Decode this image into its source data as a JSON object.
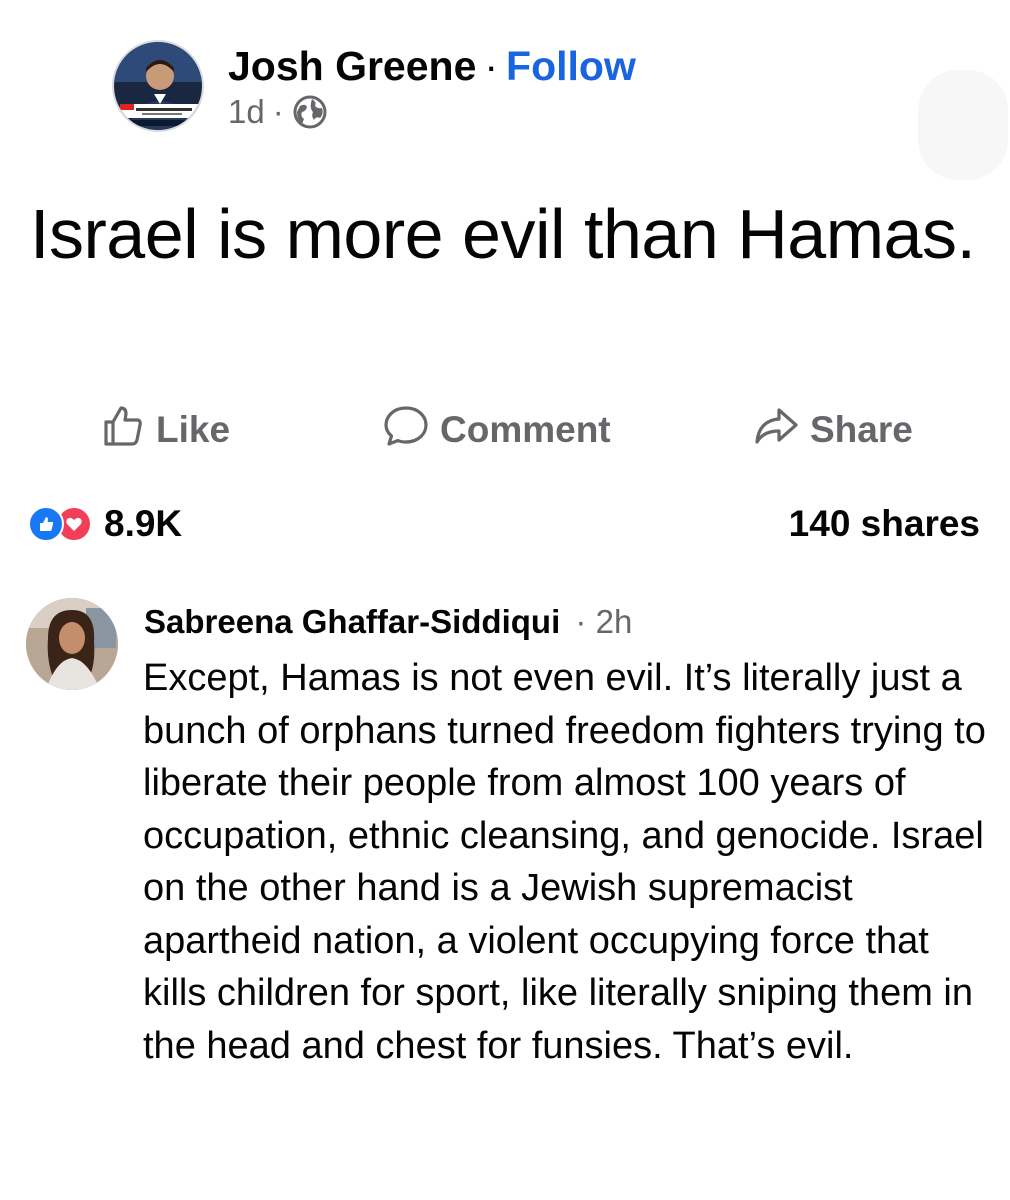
{
  "post": {
    "author": "Josh Greene",
    "separator": "·",
    "follow_label": "Follow",
    "time": "1d",
    "meta_separator": "·",
    "privacy_icon": "globe-icon",
    "text": "Israel is more evil than Hamas."
  },
  "actions": {
    "like_label": "Like",
    "comment_label": "Comment",
    "share_label": "Share"
  },
  "stats": {
    "reaction_icons": [
      "like-reaction-icon",
      "love-reaction-icon"
    ],
    "reaction_count": "8.9K",
    "shares": "140 shares"
  },
  "comment": {
    "author": "Sabreena Ghaffar-Siddiqui",
    "separator": "·",
    "time": "2h",
    "text": "Except, Hamas is not even evil. It’s literally just a bunch of orphans turned freedom fighters trying to liberate their people from almost 100 years of occupation, ethnic cleansing, and genocide. Israel on the other hand is a Jewish supremacist apartheid nation, a violent occupying force that kills children for sport, like literally sniping them in the head and chest for funsies. That’s evil."
  },
  "colors": {
    "follow": "#1b64e0",
    "secondary_text": "#65676b",
    "like_reaction": "#1877f2",
    "love_reaction": "#f33e58"
  }
}
